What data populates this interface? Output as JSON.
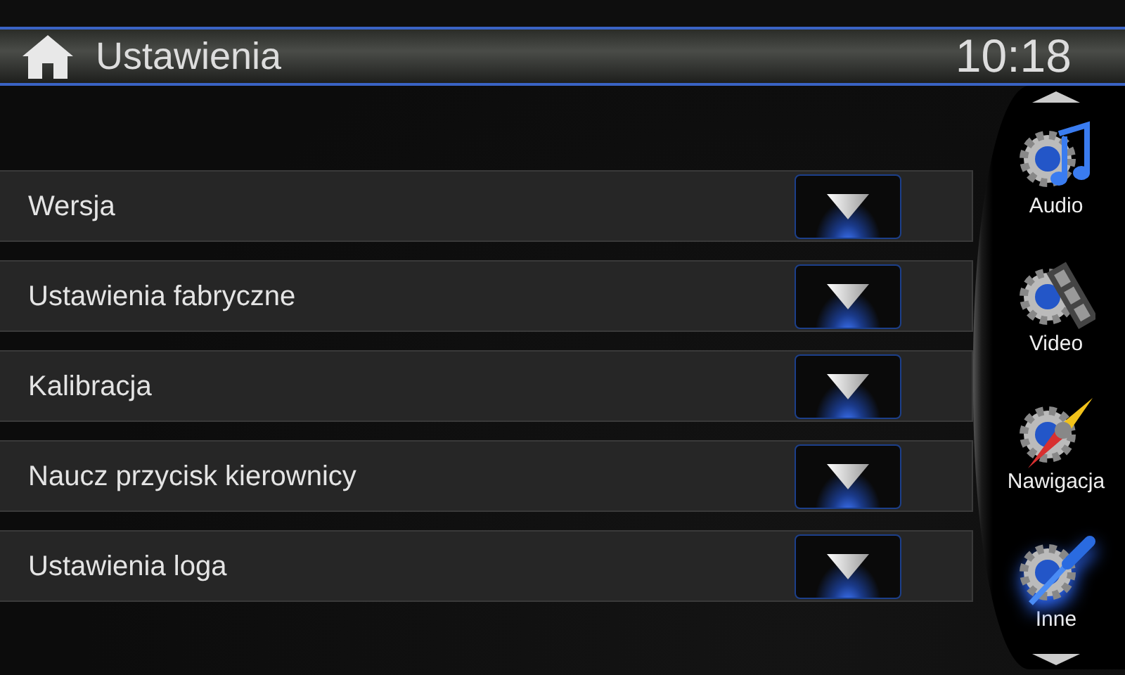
{
  "header": {
    "title": "Ustawienia",
    "time": "10:18"
  },
  "settings": [
    {
      "label": "Wersja"
    },
    {
      "label": "Ustawienia fabryczne"
    },
    {
      "label": "Kalibracja"
    },
    {
      "label": "Naucz przycisk kierownicy"
    },
    {
      "label": "Ustawienia loga"
    }
  ],
  "sidebar": {
    "items": [
      {
        "label": "Audio",
        "kind": "audio",
        "selected": false
      },
      {
        "label": "Video",
        "kind": "video",
        "selected": false
      },
      {
        "label": "Nawigacja",
        "kind": "navigation",
        "selected": false
      },
      {
        "label": "Inne",
        "kind": "tools",
        "selected": true
      }
    ]
  }
}
